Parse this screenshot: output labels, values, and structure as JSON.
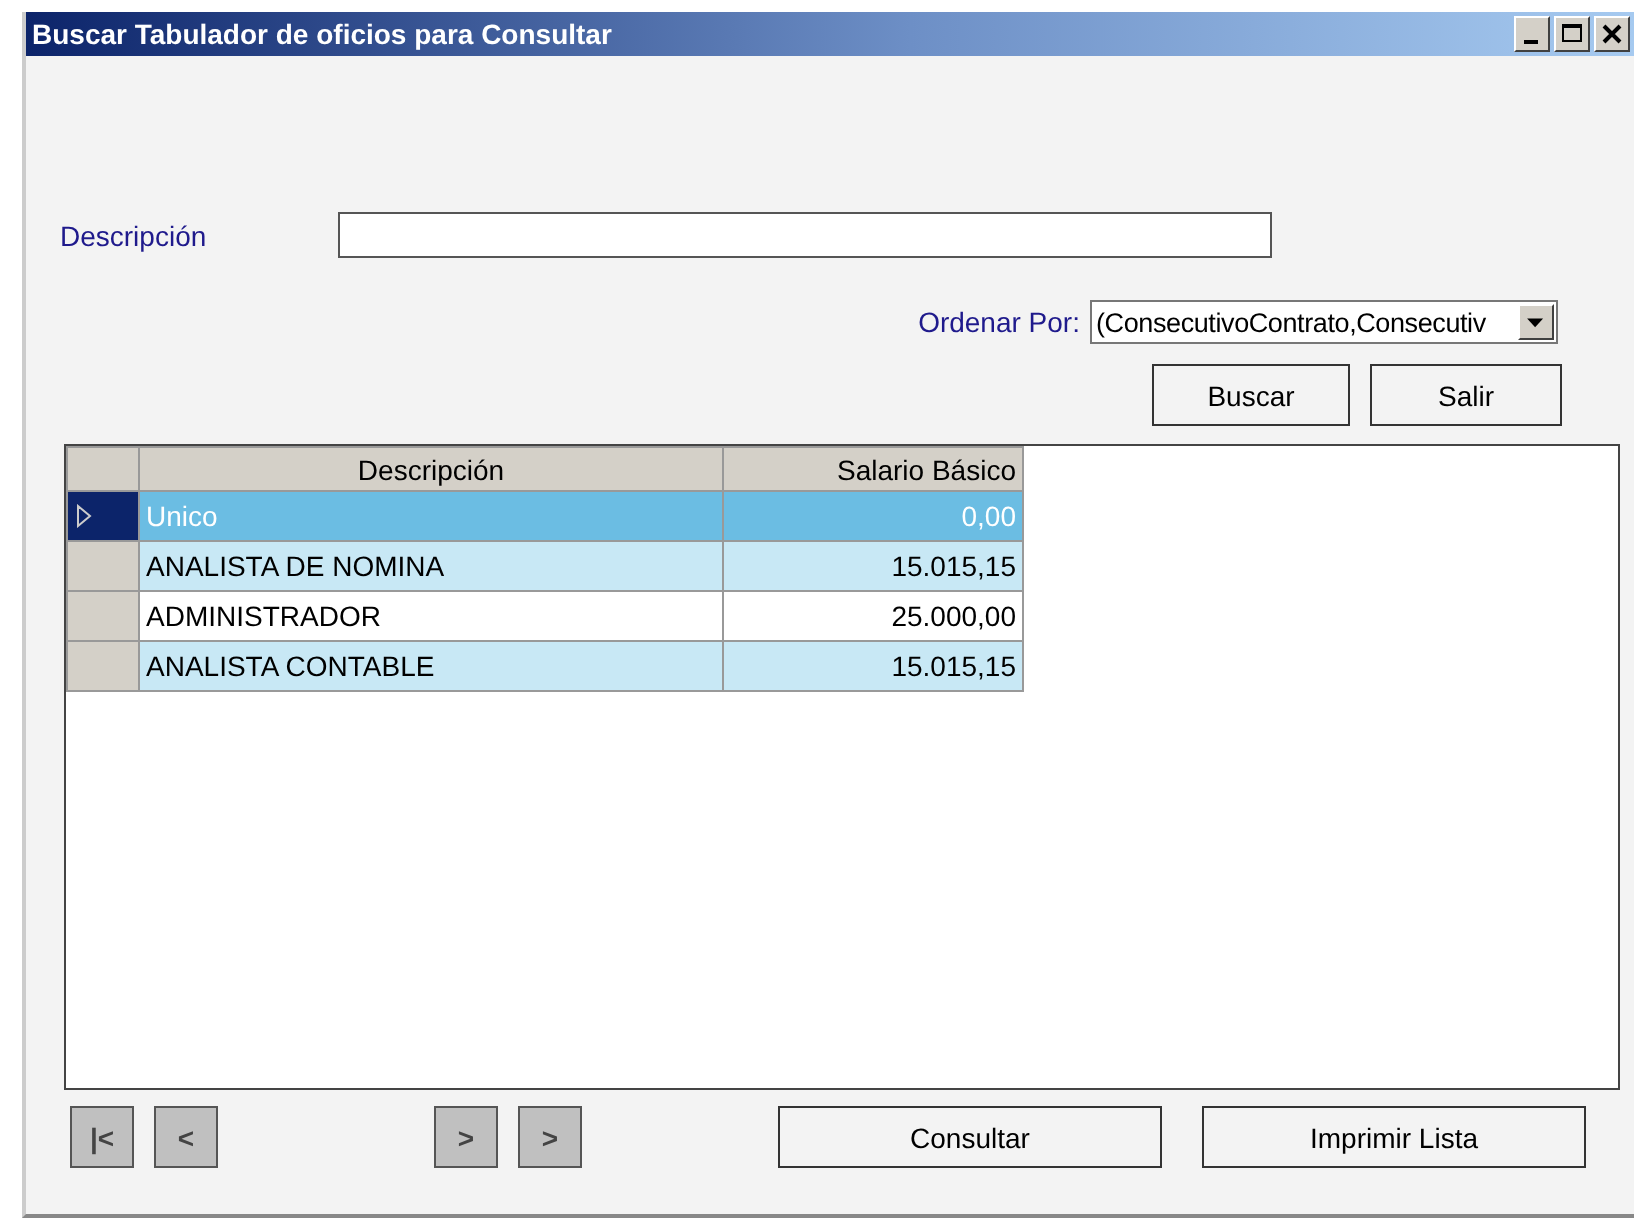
{
  "window": {
    "title": "Buscar Tabulador de oficios para Consultar"
  },
  "search": {
    "label": "Descripción"
  },
  "order": {
    "label": "Ordenar Por:",
    "value": "(ConsecutivoContrato,Consecutiv"
  },
  "buttons": [
    "Buscar",
    "Salir"
  ],
  "table": {
    "columns": [
      "Descripción",
      "Salario Básico"
    ],
    "rows": [
      {
        "cells": [
          "Unico",
          "0,00"
        ],
        "selected": true
      },
      {
        "cells": [
          "ANALISTA DE NOMINA",
          "15.015,15"
        ],
        "selected": false
      },
      {
        "cells": [
          "ADMINISTRADOR",
          "25.000,00"
        ],
        "selected": false
      },
      {
        "cells": [
          "ANALISTA CONTABLE",
          "15.015,15"
        ],
        "selected": false
      }
    ]
  },
  "navigation": [
    "|<",
    "<",
    ">",
    ">"
  ],
  "actions": [
    "Consultar",
    "Imprimir Lista"
  ]
}
